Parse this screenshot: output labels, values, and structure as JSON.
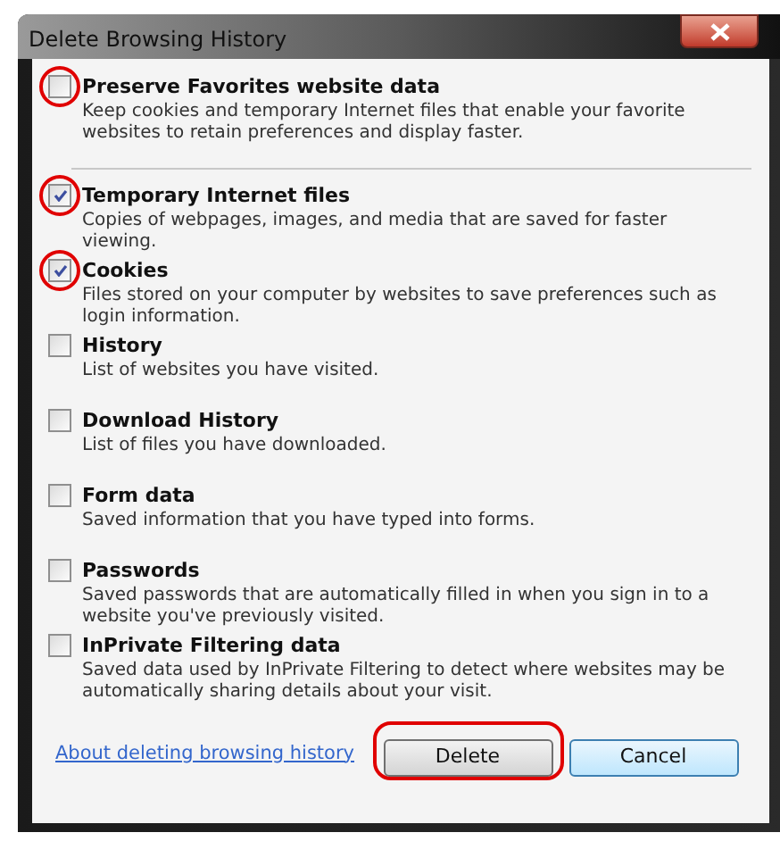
{
  "window": {
    "title": "Delete Browsing History"
  },
  "options": [
    {
      "label": "Preserve Favorites website data",
      "description": "Keep cookies and temporary Internet files that enable your favorite websites to retain preferences and display faster.",
      "checked": false,
      "circled": true
    },
    {
      "label": "Temporary Internet files",
      "description": "Copies of webpages, images, and media that are saved for faster viewing.",
      "checked": true,
      "circled": true
    },
    {
      "label": "Cookies",
      "description": "Files stored on your computer by websites to save preferences such as login information.",
      "checked": true,
      "circled": true
    },
    {
      "label": "History",
      "description": "List of websites you have visited.",
      "checked": false,
      "circled": false
    },
    {
      "label": "Download History",
      "description": "List of files you have downloaded.",
      "checked": false,
      "circled": false
    },
    {
      "label": "Form data",
      "description": "Saved information that you have typed into forms.",
      "checked": false,
      "circled": false
    },
    {
      "label": "Passwords",
      "description": "Saved passwords that are automatically filled in when you sign in to a website you've previously visited.",
      "checked": false,
      "circled": false
    },
    {
      "label": "InPrivate Filtering data",
      "description": "Saved data used by InPrivate Filtering to detect where websites may be automatically sharing details about your visit.",
      "checked": false,
      "circled": false
    }
  ],
  "link": "About deleting browsing history",
  "buttons": [
    {
      "label": "Delete",
      "circled": true
    },
    {
      "label": "Cancel",
      "circled": false
    }
  ]
}
